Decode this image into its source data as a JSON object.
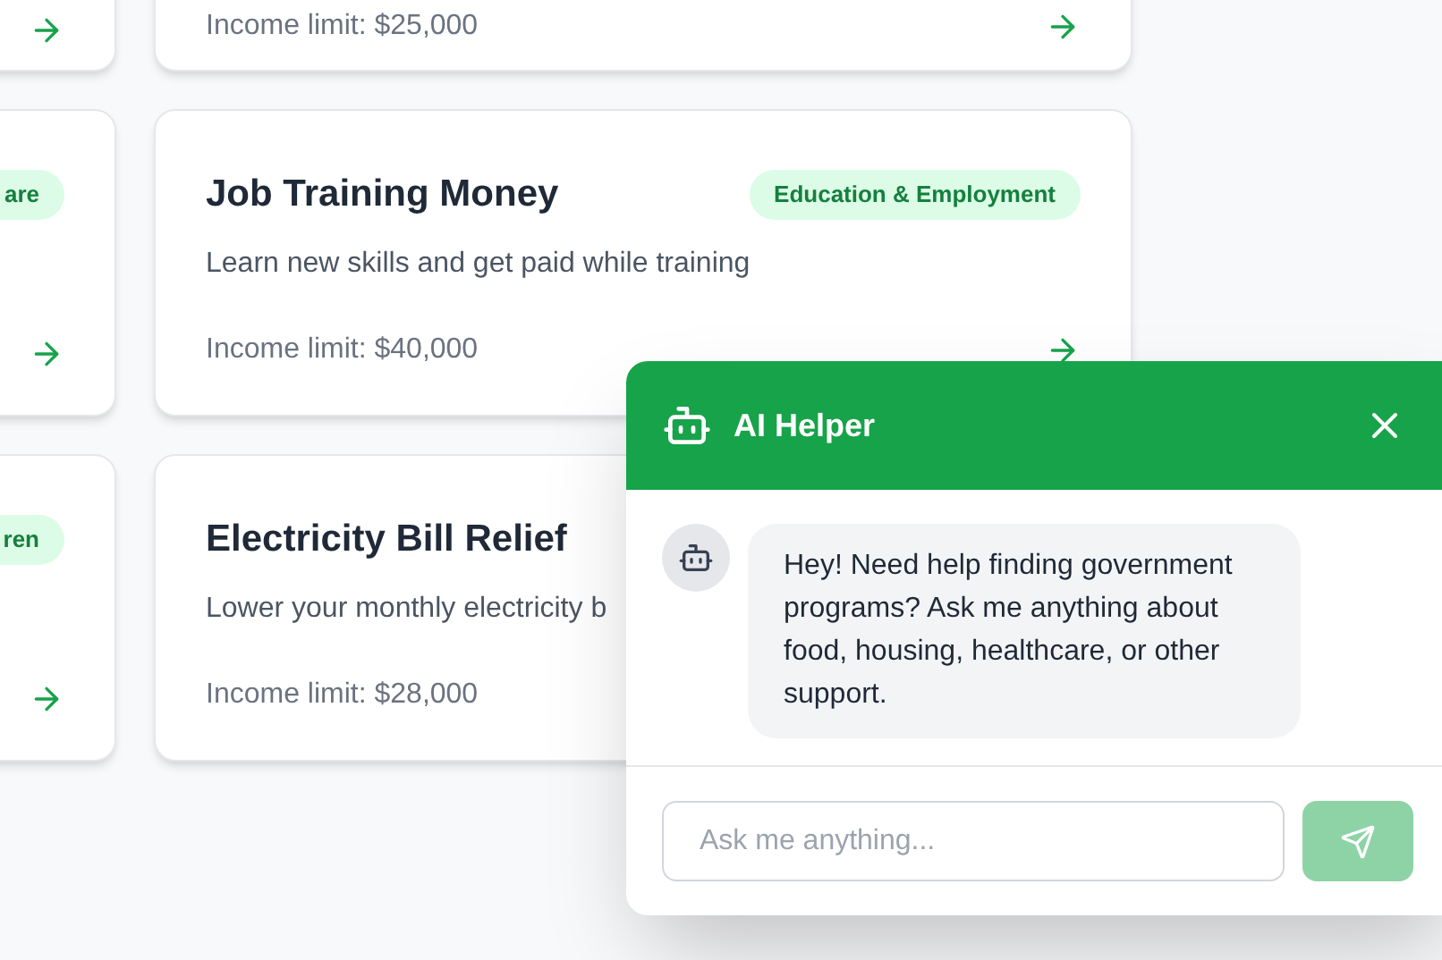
{
  "program_rows": [
    {
      "left": {},
      "right": {
        "income": "Income limit: $25,000"
      }
    },
    {
      "left": {
        "badge": "are"
      },
      "right": {
        "title": "Job Training Money",
        "badge": "Education & Employment",
        "description": "Learn new skills and get paid while training",
        "income": "Income limit: $40,000"
      }
    },
    {
      "left": {
        "badge": "ren"
      },
      "right": {
        "title": "Electricity Bill Relief",
        "description": "Lower your monthly electricity b",
        "income": "Income limit: $28,000"
      }
    }
  ],
  "chat": {
    "title": "AI Helper",
    "messages": [
      {
        "kind": "bot",
        "text": "Hey! Need help finding government programs? Ask me anything about food, housing, healthcare, or other support."
      }
    ],
    "input": {
      "placeholder": "Ask me anything..."
    },
    "send_disabled": true
  }
}
